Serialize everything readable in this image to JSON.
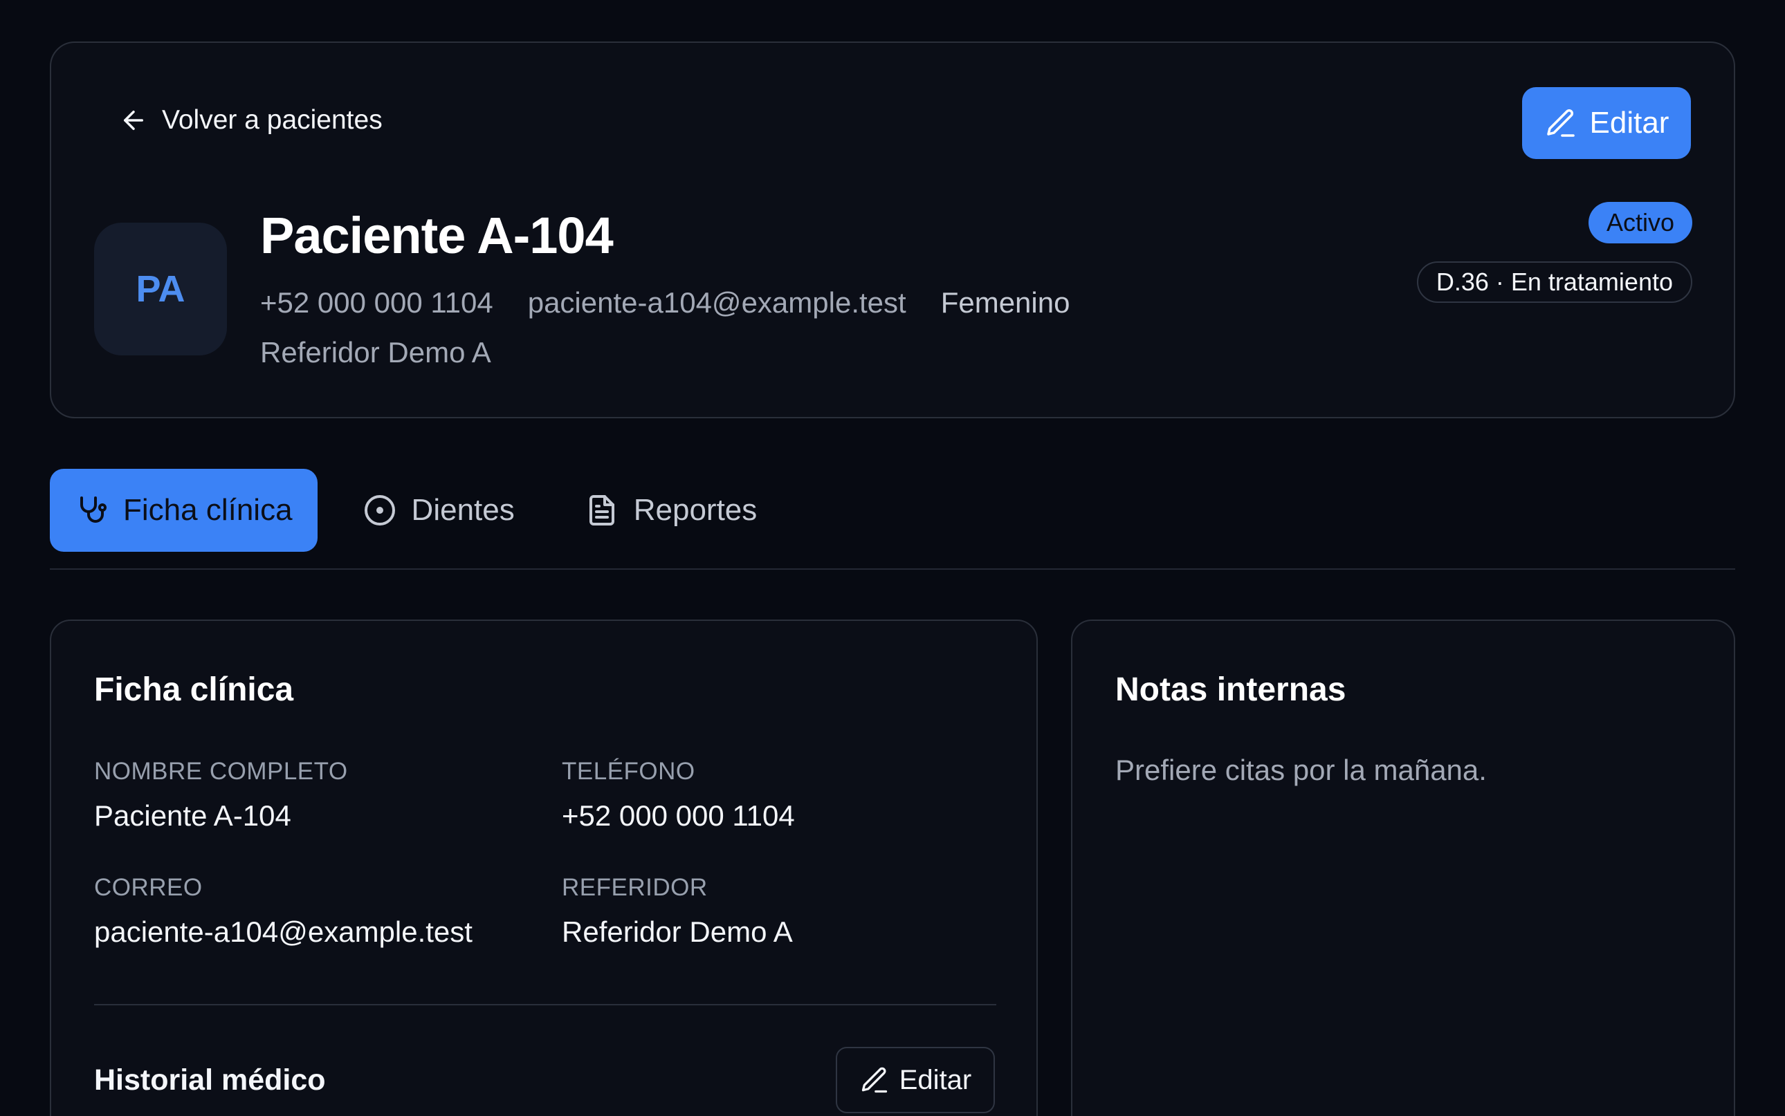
{
  "header": {
    "back_label": "Volver a pacientes",
    "edit_label": "Editar",
    "avatar_initials": "PA",
    "patient_name": "Paciente A-104",
    "phone": "+52 000 000 1104",
    "email": "paciente-a104@example.test",
    "gender": "Femenino",
    "referrer": "Referidor Demo A",
    "status_badge": "Activo",
    "treatment_badge": "D.36 · En tratamiento"
  },
  "tabs": [
    {
      "label": "Ficha clínica",
      "icon": "stethoscope-icon",
      "active": true
    },
    {
      "label": "Dientes",
      "icon": "circle-dot-icon",
      "active": false
    },
    {
      "label": "Reportes",
      "icon": "document-icon",
      "active": false
    }
  ],
  "clinical": {
    "title": "Ficha clínica",
    "fields": {
      "full_name_label": "NOMBRE COMPLETO",
      "full_name_value": "Paciente A-104",
      "phone_label": "TELÉFONO",
      "phone_value": "+52 000 000 1104",
      "email_label": "CORREO",
      "email_value": "paciente-a104@example.test",
      "referrer_label": "REFERIDOR",
      "referrer_value": "Referidor Demo A"
    },
    "history_title": "Historial médico",
    "history_edit_label": "Editar"
  },
  "notes": {
    "title": "Notas internas",
    "text": "Prefiere citas por la mañana."
  },
  "colors": {
    "accent": "#3b82f6",
    "background": "#070a12",
    "card": "#0b0e17",
    "border": "#2a2f3a"
  }
}
